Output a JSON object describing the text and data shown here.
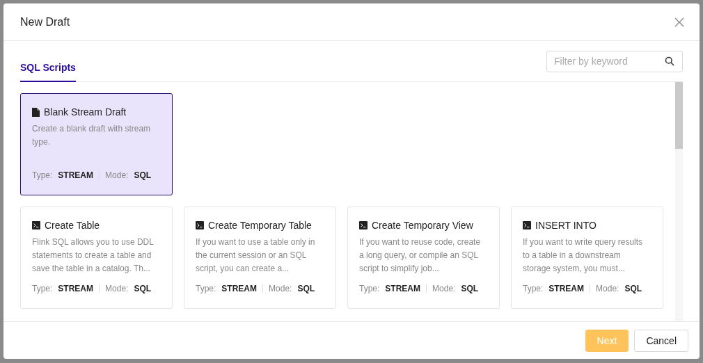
{
  "dialog": {
    "title": "New Draft"
  },
  "tabs": [
    {
      "label": "SQL Scripts",
      "selected": true
    }
  ],
  "search": {
    "placeholder": "Filter by keyword"
  },
  "templates": [
    {
      "kind": "file",
      "title": "Blank Stream Draft",
      "description": "Create a blank draft with stream type.",
      "type_label": "Type:",
      "type": "STREAM",
      "mode_label": "Mode:",
      "mode": "SQL",
      "selected": true
    },
    {
      "kind": "terminal",
      "title": "Create Table",
      "description": "Flink SQL allows you to use DDL statements to create a table and save the table in a catalog. Th...",
      "type_label": "Type:",
      "type": "STREAM",
      "mode_label": "Mode:",
      "mode": "SQL",
      "selected": false
    },
    {
      "kind": "terminal",
      "title": "Create Temporary Table",
      "description": "If you want to use a table only in the current session or an SQL script, you can create a...",
      "type_label": "Type:",
      "type": "STREAM",
      "mode_label": "Mode:",
      "mode": "SQL",
      "selected": false
    },
    {
      "kind": "terminal",
      "title": "Create Temporary View",
      "description": "If you want to reuse code, create a long query, or compile an SQL script to simplify job...",
      "type_label": "Type:",
      "type": "STREAM",
      "mode_label": "Mode:",
      "mode": "SQL",
      "selected": false
    },
    {
      "kind": "terminal",
      "title": "INSERT INTO",
      "description": "If you want to write query results to a table in a downstream storage system, you must...",
      "type_label": "Type:",
      "type": "STREAM",
      "mode_label": "Mode:",
      "mode": "SQL",
      "selected": false
    }
  ],
  "buttons": [
    {
      "label": "Next",
      "kind": "primary",
      "disabled": true
    },
    {
      "label": "Cancel",
      "kind": "default",
      "disabled": false
    }
  ]
}
